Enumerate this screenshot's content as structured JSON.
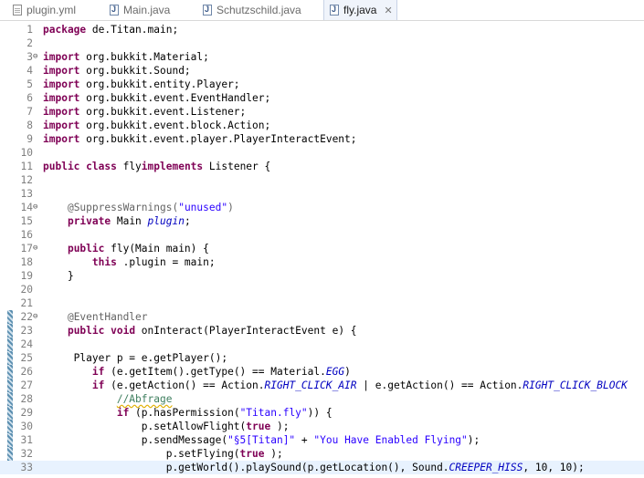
{
  "tabs": [
    {
      "label": "plugin.yml",
      "icon": "yml-file-icon",
      "active": false
    },
    {
      "label": "Main.java",
      "icon": "java-file-icon",
      "active": false
    },
    {
      "label": "Schutzschild.java",
      "icon": "java-file-icon",
      "active": false
    },
    {
      "label": "fly.java",
      "icon": "java-file-icon",
      "active": true
    }
  ],
  "close_glyph": "✕",
  "editor": {
    "current_line": 33,
    "fold_lines": [
      3,
      14,
      17,
      22
    ],
    "ruler_marked_lines": [
      22,
      23,
      24,
      25,
      26,
      27,
      28,
      29,
      30,
      31,
      32,
      33
    ],
    "lines": [
      {
        "n": "1",
        "segs": [
          [
            "kw",
            "package"
          ],
          [
            "",
            "de.Titan.main;"
          ]
        ]
      },
      {
        "n": "2",
        "segs": []
      },
      {
        "n": "3",
        "segs": [
          [
            "kw",
            "import"
          ],
          [
            "",
            "org.bukkit.Material;"
          ]
        ]
      },
      {
        "n": "4",
        "segs": [
          [
            "kw",
            "import"
          ],
          [
            "",
            "org.bukkit.Sound;"
          ]
        ]
      },
      {
        "n": "5",
        "segs": [
          [
            "kw",
            "import"
          ],
          [
            "",
            "org.bukkit.entity.Player;"
          ]
        ]
      },
      {
        "n": "6",
        "segs": [
          [
            "kw",
            "import"
          ],
          [
            "",
            "org.bukkit.event.EventHandler;"
          ]
        ]
      },
      {
        "n": "7",
        "segs": [
          [
            "kw",
            "import"
          ],
          [
            "",
            "org.bukkit.event.Listener;"
          ]
        ]
      },
      {
        "n": "8",
        "segs": [
          [
            "kw",
            "import"
          ],
          [
            "",
            "org.bukkit.event.block.Action;"
          ]
        ]
      },
      {
        "n": "9",
        "segs": [
          [
            "kw",
            "import"
          ],
          [
            "",
            "org.bukkit.event.player.PlayerInteractEvent;"
          ]
        ]
      },
      {
        "n": "10",
        "segs": []
      },
      {
        "n": "11",
        "segs": [
          [
            "kw",
            "public"
          ],
          [
            "kw",
            "class"
          ],
          [
            "",
            "fly"
          ],
          [
            "kw",
            "implements"
          ],
          [
            "",
            "Listener {"
          ]
        ]
      },
      {
        "n": "12",
        "segs": []
      },
      {
        "n": "13",
        "segs": []
      },
      {
        "n": "14",
        "segs": [
          [
            "",
            "    "
          ],
          [
            "ann",
            "@SuppressWarnings("
          ],
          [
            "str",
            "\"unused\""
          ],
          [
            "ann",
            ")"
          ]
        ]
      },
      {
        "n": "15",
        "segs": [
          [
            "",
            "    "
          ],
          [
            "kw",
            "private"
          ],
          [
            "",
            "Main "
          ],
          [
            "const",
            "plugin"
          ],
          [
            ";",
            ""
          ]
        ]
      },
      {
        "n": "16",
        "segs": []
      },
      {
        "n": "17",
        "segs": [
          [
            "",
            "    "
          ],
          [
            "kw",
            "public"
          ],
          [
            "",
            "fly(Main main) {"
          ]
        ]
      },
      {
        "n": "18",
        "segs": [
          [
            "",
            "        "
          ],
          [
            "kw",
            "this"
          ],
          [
            "",
            ".plugin = main;"
          ]
        ]
      },
      {
        "n": "19",
        "segs": [
          [
            "",
            "    }"
          ]
        ]
      },
      {
        "n": "20",
        "segs": []
      },
      {
        "n": "21",
        "segs": []
      },
      {
        "n": "22",
        "segs": [
          [
            "",
            "    "
          ],
          [
            "ann",
            "@EventHandler"
          ]
        ]
      },
      {
        "n": "23",
        "segs": [
          [
            "",
            "    "
          ],
          [
            "kw",
            "public"
          ],
          [
            "kw",
            "void"
          ],
          [
            "",
            "onInteract(PlayerInteractEvent e) {"
          ]
        ]
      },
      {
        "n": "24",
        "segs": []
      },
      {
        "n": "25",
        "segs": [
          [
            "",
            "     Player p = e.getPlayer();"
          ]
        ]
      },
      {
        "n": "26",
        "segs": [
          [
            "",
            "        "
          ],
          [
            "kw",
            "if"
          ],
          [
            "",
            "(e.getItem().getType() == Material."
          ],
          [
            "const",
            "EGG"
          ],
          [
            "",
            ")"
          ]
        ]
      },
      {
        "n": "27",
        "segs": [
          [
            "",
            "        "
          ],
          [
            "kw",
            "if"
          ],
          [
            "",
            "(e.getAction() == Action."
          ],
          [
            "const",
            "RIGHT_CLICK_AIR"
          ],
          [
            "",
            " | e.getAction() == Action."
          ],
          [
            "const",
            "RIGHT_CLICK_BLOCK"
          ]
        ]
      },
      {
        "n": "28",
        "segs": [
          [
            "",
            "            "
          ],
          [
            "com",
            "//Abfrage"
          ]
        ]
      },
      {
        "n": "29",
        "segs": [
          [
            "",
            "            "
          ],
          [
            "kw",
            "if"
          ],
          [
            "",
            "(p.hasPermission("
          ],
          [
            "str",
            "\"Titan.fly\""
          ],
          [
            "",
            ")) {"
          ]
        ]
      },
      {
        "n": "30",
        "segs": [
          [
            "",
            "                p.setAllowFlight("
          ],
          [
            "kw",
            "true"
          ],
          [
            "",
            ");"
          ]
        ]
      },
      {
        "n": "31",
        "segs": [
          [
            "",
            "                p.sendMessage("
          ],
          [
            "str",
            "\"§5[Titan]\""
          ],
          [
            "",
            " + "
          ],
          [
            "str",
            "\"You Have Enabled Flying\""
          ],
          [
            "",
            ");"
          ]
        ]
      },
      {
        "n": "32",
        "segs": [
          [
            "",
            "                    p.setFlying("
          ],
          [
            "kw",
            "true"
          ],
          [
            "",
            ");"
          ]
        ]
      },
      {
        "n": "33",
        "segs": [
          [
            "",
            "                    p.getWorld().playSound(p.getLocation(), Sound."
          ],
          [
            "const",
            "CREEPER_HISS"
          ],
          [
            "",
            ", 10, 10);"
          ]
        ]
      }
    ]
  }
}
